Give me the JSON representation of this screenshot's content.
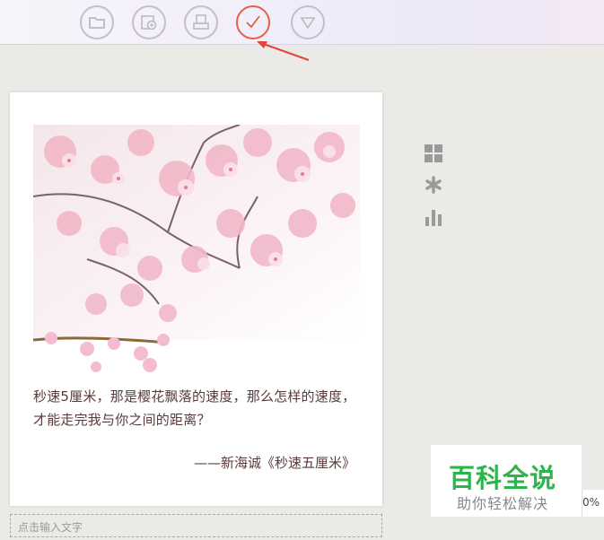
{
  "toolbar": {
    "buttons": [
      {
        "icon": "folder-icon"
      },
      {
        "icon": "camera-film-icon"
      },
      {
        "icon": "print-icon"
      },
      {
        "icon": "check-icon",
        "active": true
      },
      {
        "icon": "triangle-down-icon"
      }
    ]
  },
  "card": {
    "quote": "秒速5厘米，那是樱花飘落的速度，那么怎样的速度，才能走完我与你之间的距离？",
    "source": "——新海诚《秒速五厘米》"
  },
  "caption": {
    "placeholder": "点击输入文字"
  },
  "side_tools": [
    "grid-icon",
    "asterisk-icon",
    "bar-chart-icon"
  ],
  "watermark": {
    "title": "百科全说",
    "subtitle": "助你轻松解决"
  },
  "percent_label": "0%",
  "colors": {
    "accent": "#e8603c",
    "text": "#5a3a3a",
    "watermark_green": "#2cb54a"
  }
}
